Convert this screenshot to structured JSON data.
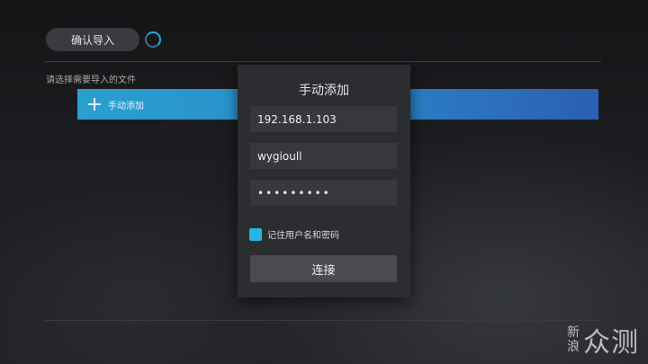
{
  "header": {
    "confirm_import_label": "确认导入"
  },
  "main": {
    "section_label": "请选择需要导入的文件",
    "add_item_label": "手动添加"
  },
  "dialog": {
    "title": "手动添加",
    "ip_value": "192.168.1.103",
    "username_value": "wygioull",
    "password_masked": "•••••••••",
    "remember_label": "记住用户名和密码",
    "remember_checked": true,
    "connect_label": "连接"
  },
  "watermark": {
    "line1": "新",
    "line2": "浪",
    "brand": "众测"
  },
  "colors": {
    "accent": "#29b6e4",
    "bar_start": "#2aa0ce",
    "bar_end": "#2c5fb2"
  }
}
